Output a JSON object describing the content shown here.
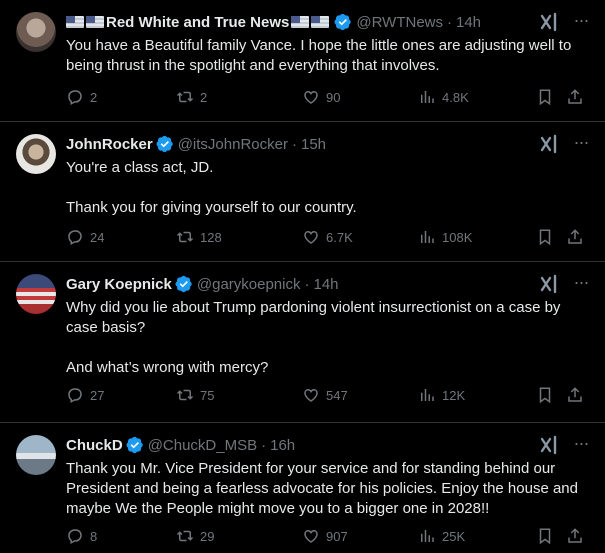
{
  "tweets": [
    {
      "display_name": "Red White and True News",
      "handle": "@RWTNews",
      "time": "14h",
      "text": "You have a Beautiful family Vance. I hope the little ones are adjusting well to being thrust in the spotlight and everything that involves.",
      "replies": "2",
      "reposts": "2",
      "likes": "90",
      "views": "4.8K"
    },
    {
      "display_name": "JohnRocker",
      "handle": "@itsJohnRocker",
      "time": "15h",
      "text": "You're a class act, JD.\n\nThank you for giving yourself to our country.",
      "replies": "24",
      "reposts": "128",
      "likes": "6.7K",
      "views": "108K"
    },
    {
      "display_name": "Gary Koepnick",
      "handle": "@garykoepnick",
      "time": "14h",
      "text": "Why did you lie about Trump pardoning violent insurrectionist on a case by case basis?\n\nAnd what’s wrong with mercy?",
      "replies": "27",
      "reposts": "75",
      "likes": "547",
      "views": "12K"
    },
    {
      "display_name": "ChuckD",
      "handle": "@ChuckD_MSB",
      "time": "16h",
      "text": "Thank you Mr. Vice President for your service and for standing behind our President and being a fearless advocate for his policies. Enjoy the house and maybe We the People might move you to a bigger one in 2028!!",
      "replies": "8",
      "reposts": "29",
      "likes": "907",
      "views": "25K"
    }
  ],
  "colors": {
    "background": "#000000",
    "text": "#e7e9ea",
    "muted": "#71767b",
    "verified": "#1d9bf0",
    "divider": "#2f3336"
  },
  "icons": [
    "verified-badge-icon",
    "grok-icon",
    "more-icon",
    "reply-icon",
    "repost-icon",
    "like-icon",
    "views-icon",
    "bookmark-icon",
    "share-icon",
    "flag-icon"
  ]
}
